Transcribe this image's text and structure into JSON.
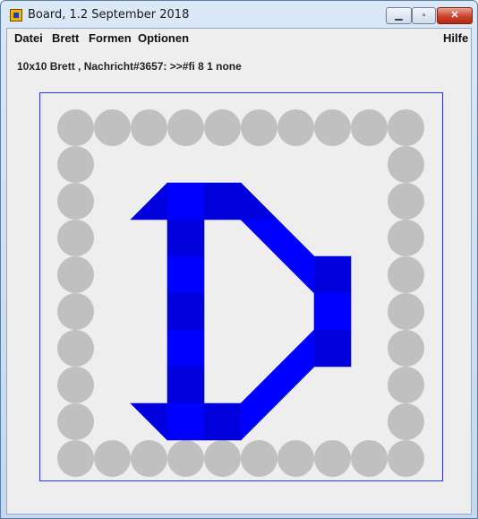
{
  "window": {
    "title": "Board, 1.2 September 2018",
    "minimize_glyph": "▁",
    "maximize_glyph": "▫",
    "close_glyph": "✕"
  },
  "menu": {
    "items": [
      "Datei",
      "Brett",
      "Formen",
      "Optionen"
    ],
    "help": "Hilfe"
  },
  "status": {
    "message": "10x10 Brett , Nachricht#3657: >>#fi 8 1 none"
  },
  "board": {
    "size": 10,
    "frame_color": "#3030ff",
    "background_color": "#eeeeee",
    "empty_color": "#c0c0c0",
    "fill_color_light": "#0000ff",
    "fill_color_dark": "#0000dd",
    "circles": [
      [
        0,
        0
      ],
      [
        1,
        0
      ],
      [
        2,
        0
      ],
      [
        3,
        0
      ],
      [
        4,
        0
      ],
      [
        5,
        0
      ],
      [
        6,
        0
      ],
      [
        7,
        0
      ],
      [
        8,
        0
      ],
      [
        9,
        0
      ],
      [
        0,
        1
      ],
      [
        9,
        1
      ],
      [
        0,
        2
      ],
      [
        9,
        2
      ],
      [
        0,
        3
      ],
      [
        9,
        3
      ],
      [
        0,
        4
      ],
      [
        9,
        4
      ],
      [
        0,
        5
      ],
      [
        9,
        5
      ],
      [
        0,
        6
      ],
      [
        9,
        6
      ],
      [
        0,
        7
      ],
      [
        9,
        7
      ],
      [
        0,
        8
      ],
      [
        9,
        8
      ],
      [
        0,
        9
      ],
      [
        1,
        9
      ],
      [
        2,
        9
      ],
      [
        3,
        9
      ],
      [
        4,
        9
      ],
      [
        5,
        9
      ],
      [
        6,
        9
      ],
      [
        7,
        9
      ],
      [
        8,
        9
      ],
      [
        9,
        9
      ]
    ],
    "cells": [
      {
        "col": 2,
        "row": 2,
        "shape": "tri-br",
        "shade": "dark"
      },
      {
        "col": 3,
        "row": 2,
        "shape": "full",
        "shade": "light"
      },
      {
        "col": 4,
        "row": 2,
        "shape": "full",
        "shade": "dark"
      },
      {
        "col": 5,
        "row": 2,
        "shape": "tri-bl",
        "shade": "dark"
      },
      {
        "col": 3,
        "row": 3,
        "shape": "full",
        "shade": "dark"
      },
      {
        "col": 5,
        "row": 3,
        "shape": "tri-tr",
        "shade": "light"
      },
      {
        "col": 6,
        "row": 3,
        "shape": "tri-bl",
        "shade": "light"
      },
      {
        "col": 3,
        "row": 4,
        "shape": "full",
        "shade": "light"
      },
      {
        "col": 6,
        "row": 4,
        "shape": "tri-tr",
        "shade": "light"
      },
      {
        "col": 7,
        "row": 4,
        "shape": "full",
        "shade": "dark"
      },
      {
        "col": 3,
        "row": 5,
        "shape": "full",
        "shade": "dark"
      },
      {
        "col": 7,
        "row": 5,
        "shape": "full",
        "shade": "light"
      },
      {
        "col": 3,
        "row": 6,
        "shape": "full",
        "shade": "light"
      },
      {
        "col": 6,
        "row": 6,
        "shape": "tri-br",
        "shade": "light"
      },
      {
        "col": 7,
        "row": 6,
        "shape": "full",
        "shade": "dark"
      },
      {
        "col": 3,
        "row": 7,
        "shape": "full",
        "shade": "dark"
      },
      {
        "col": 5,
        "row": 7,
        "shape": "tri-br",
        "shade": "light"
      },
      {
        "col": 6,
        "row": 7,
        "shape": "tri-tl",
        "shade": "light"
      },
      {
        "col": 2,
        "row": 8,
        "shape": "tri-tr",
        "shade": "dark"
      },
      {
        "col": 3,
        "row": 8,
        "shape": "full",
        "shade": "light"
      },
      {
        "col": 4,
        "row": 8,
        "shape": "full",
        "shade": "dark"
      },
      {
        "col": 5,
        "row": 8,
        "shape": "tri-tl",
        "shade": "light"
      }
    ]
  }
}
